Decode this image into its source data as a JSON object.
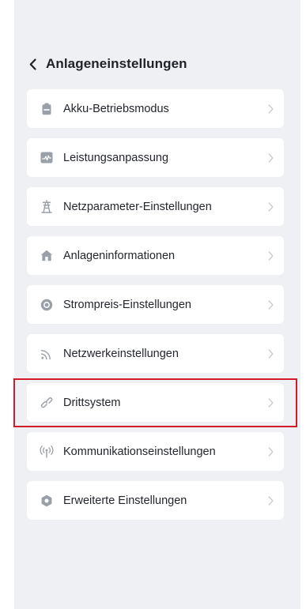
{
  "header": {
    "back_icon": "chevron-left-icon",
    "title": "Anlageneinstellungen"
  },
  "colors": {
    "background": "#eef0f3",
    "card": "#ffffff",
    "text": "#23262d",
    "icon": "#9aa0a8",
    "chevron": "#c8ccd2",
    "highlight": "#d11a2a"
  },
  "menu": {
    "items": [
      {
        "label": "Akku-Betriebsmodus",
        "icon": "battery-icon"
      },
      {
        "label": "Leistungsanpassung",
        "icon": "power-adjust-icon"
      },
      {
        "label": "Netzparameter-Einstellungen",
        "icon": "grid-tower-icon"
      },
      {
        "label": "Anlageninformationen",
        "icon": "home-icon"
      },
      {
        "label": "Strompreis-Einstellungen",
        "icon": "price-coin-icon"
      },
      {
        "label": "Netzwerkeinstellungen",
        "icon": "wifi-icon"
      },
      {
        "label": "Drittsystem",
        "icon": "link-icon",
        "highlighted": true
      },
      {
        "label": "Kommunikationseinstellungen",
        "icon": "antenna-icon"
      },
      {
        "label": "Erweiterte Einstellungen",
        "icon": "gear-icon"
      }
    ]
  }
}
